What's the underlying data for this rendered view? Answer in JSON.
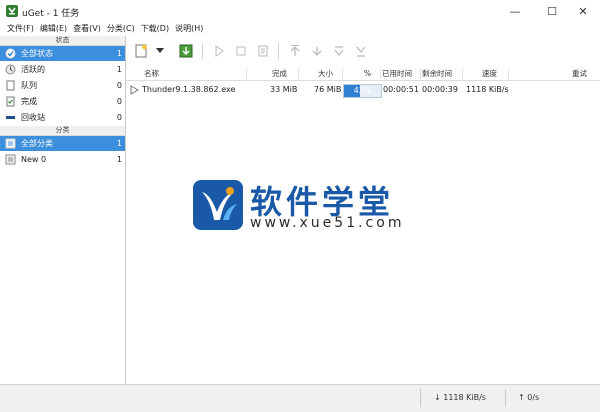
{
  "window": {
    "title": "uGet - 1 任务",
    "minimize": "—",
    "maximize": "☐",
    "close": "✕"
  },
  "menu": [
    {
      "label": "文件(F)"
    },
    {
      "label": "编辑(E)"
    },
    {
      "label": "查看(V)"
    },
    {
      "label": "分类(C)"
    },
    {
      "label": "下载(D)"
    },
    {
      "label": "说明(H)"
    }
  ],
  "sidebar": {
    "status_header": "状态",
    "status_items": [
      {
        "label": "全部状态",
        "count": "1",
        "icon": "all-status-icon"
      },
      {
        "label": "活跃的",
        "count": "1",
        "icon": "active-icon"
      },
      {
        "label": "队列",
        "count": "0",
        "icon": "queue-icon"
      },
      {
        "label": "完成",
        "count": "0",
        "icon": "finished-icon"
      },
      {
        "label": "回收站",
        "count": "0",
        "icon": "recycle-icon"
      }
    ],
    "category_header": "分类",
    "category_items": [
      {
        "label": "全部分类",
        "count": "1",
        "icon": "all-category-icon"
      },
      {
        "label": "New 0",
        "count": "1",
        "icon": "category-icon"
      }
    ]
  },
  "list": {
    "headers": {
      "name": "名称",
      "complete": "完成",
      "size": "大小",
      "percent": "%",
      "elapsed": "已用时间",
      "remaining": "剩余时间",
      "speed": "速度",
      "retry": "重试"
    },
    "rows": [
      {
        "name": "Thunder9.1.38.862.exe",
        "complete": "33 MiB",
        "size": "76 MiB",
        "percent_text": "43%",
        "progress": 0.43,
        "elapsed": "00:00:51",
        "remaining": "00:00:39",
        "speed": "1118 KiB/s",
        "retry": ""
      }
    ]
  },
  "status_bar": {
    "download_speed": "↓ 1118 KiB/s",
    "upload_speed": "↑ 0/s"
  },
  "watermark": {
    "title": "软件学堂",
    "url": "www.xue51.com"
  },
  "colors": {
    "selection": "#3c8fdd",
    "progress": "#2f7fd3",
    "watermark_blue": "#1a58a8"
  }
}
